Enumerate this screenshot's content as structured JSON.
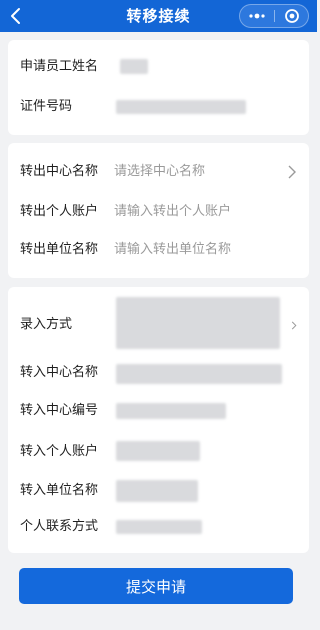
{
  "header": {
    "title": "转移接续"
  },
  "section_basic": {
    "applicant_name_label": "申请员工姓名",
    "id_number_label": "证件号码"
  },
  "section_transfer_out": {
    "center_label": "转出中心名称",
    "center_placeholder": "请选择中心名称",
    "account_label": "转出个人账户",
    "account_placeholder": "请输入转出个人账户",
    "unit_label": "转出单位名称",
    "unit_placeholder": "请输入转出单位名称"
  },
  "section_transfer_in": {
    "entry_method_label": "录入方式",
    "center_label": "转入中心名称",
    "center_code_label": "转入中心编号",
    "account_label": "转入个人账户",
    "unit_label": "转入单位名称",
    "contact_label": "个人联系方式"
  },
  "submit_label": "提交申请"
}
